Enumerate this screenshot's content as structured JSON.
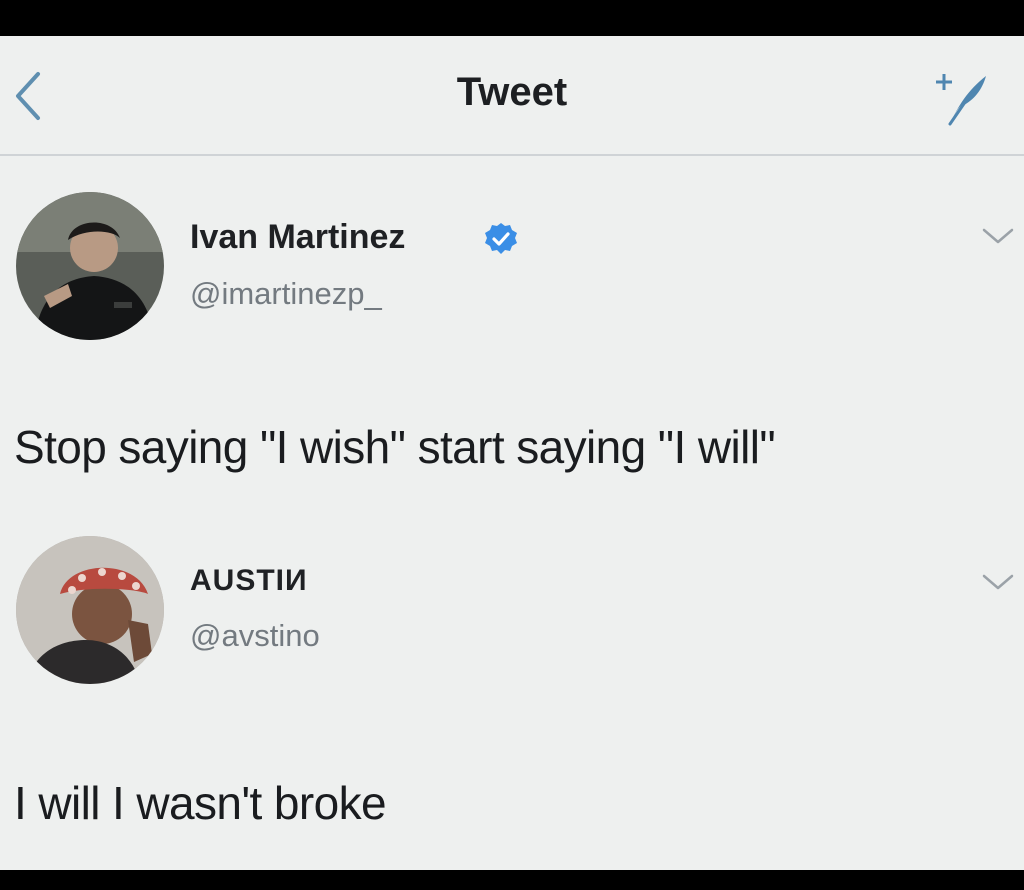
{
  "header": {
    "title": "Tweet",
    "back_icon": "chevron-left-icon",
    "compose_icon": "compose-tweet-icon"
  },
  "tweet": {
    "author": {
      "name": "Ivan Martinez",
      "handle": "@imartinezp_",
      "verified": true
    },
    "text": "Stop saying \"I wish\" start saying \"I will\""
  },
  "reply": {
    "author": {
      "name": "AUSTIИ",
      "handle": "@avstino"
    },
    "text": "I will I wasn't broke"
  },
  "colors": {
    "background": "#eef0ef",
    "verified_badge": "#3a8ee6",
    "secondary_text": "#737a80"
  }
}
